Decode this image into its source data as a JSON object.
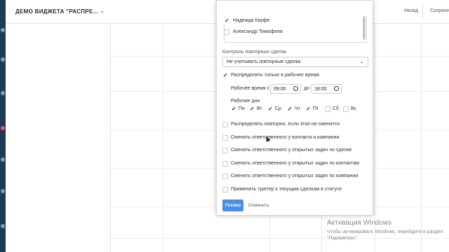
{
  "header": {
    "title": "ДЕМО ВИДЖЕТА \"РАСПРЕ...",
    "back_label": "Назад",
    "save_label": "Сохранить"
  },
  "users": [
    "Надежда Кауфе",
    "Александр Тимофеев"
  ],
  "repeat_control": {
    "label": "Контроль повторных сделок",
    "value": "Не учитывать повторные сделки"
  },
  "work_time": {
    "checkbox_label": "Распределять только в рабочее время",
    "checked": true,
    "time_label": "Рабочее время с",
    "from": "09:00",
    "to_label": "до",
    "to": "18:00",
    "days_label": "Рабочие дни",
    "days": [
      {
        "label": "Пн",
        "checked": true
      },
      {
        "label": "Вт",
        "checked": true
      },
      {
        "label": "Ср",
        "checked": true
      },
      {
        "label": "Чт",
        "checked": true
      },
      {
        "label": "Пт",
        "checked": true
      },
      {
        "label": "Сб",
        "checked": false
      },
      {
        "label": "Вс",
        "checked": false
      }
    ]
  },
  "options": [
    {
      "label": "Распределять повторно, если этап не сменится",
      "checked": false
    },
    {
      "label": "Сменить ответственного у контакта и компании",
      "checked": false
    },
    {
      "label": "Сменить ответственного у открытых задач по сделке",
      "checked": false
    },
    {
      "label": "Сменить ответственного у открытых задач по контактам",
      "checked": false
    },
    {
      "label": "Сменить ответственного у открытых задач по компании",
      "checked": false
    },
    {
      "label": "Применить триггер к текущим сделкам в статусе",
      "checked": false
    }
  ],
  "buttons": {
    "done": "Готово",
    "cancel": "Отменить"
  },
  "watermark": {
    "title": "Активация Windows",
    "text": "Чтобы активировать Windows, перейдите в раздел \"Параметры\"."
  },
  "colors": {
    "primary": "#4a8ee8",
    "sidebar": "#1f3a55"
  }
}
